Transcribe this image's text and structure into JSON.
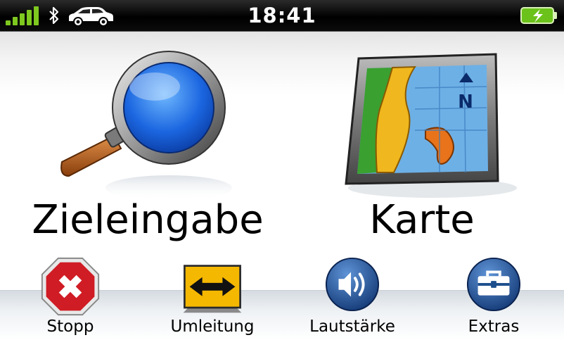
{
  "status": {
    "time": "18:41",
    "signal": "signal-bars-icon",
    "bluetooth": "bluetooth-icon",
    "vehicle": "car-icon",
    "battery": "battery-charging-icon"
  },
  "main": {
    "destination_label": "Zieleingabe",
    "map_label": "Karte",
    "map_compass": "N"
  },
  "dock": {
    "stop_label": "Stopp",
    "detour_label": "Umleitung",
    "volume_label": "Lautstärke",
    "extras_label": "Extras"
  },
  "colors": {
    "signal_green": "#7ec81f",
    "stop_red": "#d01c24",
    "detour_yellow": "#f5b800",
    "round_blue": "#1c4e8c"
  }
}
